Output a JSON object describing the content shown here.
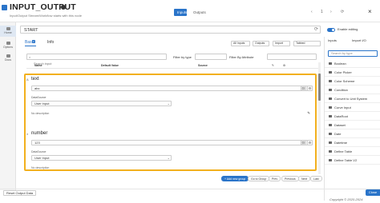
{
  "header": {
    "title": "INPUT_OUTPUT",
    "subtitle": "Input/Output Stream/Workflow starts with this node",
    "tabs": [
      "Inputs",
      "Outputs"
    ],
    "controls": [
      "‹",
      "1",
      "›",
      "⟳"
    ],
    "close": "×"
  },
  "left_nav": [
    {
      "label": "Home",
      "icon": "home-icon"
    },
    {
      "label": "Options",
      "icon": "options-icon"
    },
    {
      "label": "Docs",
      "icon": "docs-icon"
    }
  ],
  "name": {
    "value": "START",
    "refresh": "⟳"
  },
  "editing": {
    "label": "Enable editing",
    "enabled": true
  },
  "tabs": {
    "basic": "Basic",
    "basic_count": "2",
    "info": "Info"
  },
  "toolbar": {
    "all_inputs": "All Inputs",
    "outputs": "Outputs",
    "import": "Import",
    "view": "Tabbed"
  },
  "search": {
    "placeholder": "Search input"
  },
  "filters": {
    "type_label": "Filter by type",
    "attr_label": "Filter By Attribute"
  },
  "columns": {
    "name": "Name",
    "default": "Default Value",
    "source": "Source"
  },
  "inputs": [
    {
      "icon": "A",
      "name": "text",
      "value": "abc",
      "datasource_label": "DataSource",
      "datasource": "User Input",
      "description": "No description"
    },
    {
      "icon": "±",
      "name": "number",
      "value": "123",
      "datasource_label": "DataSource",
      "datasource": "User Input",
      "description": "No description"
    }
  ],
  "bottom_buttons": [
    "+ Add new group",
    "Go to Group",
    "Prev",
    "Previous",
    "Next",
    "Last"
  ],
  "right_panel": {
    "tabs": [
      "Inputs",
      "Import I/O"
    ],
    "search_placeholder": "Search by type",
    "items": [
      "Boolean",
      "Color Picker",
      "Color Scheme",
      "Condition",
      "Convert to Unit System",
      "Curve Input",
      "DataRoot",
      "Dataset",
      "Date",
      "Datetime",
      "Define Table",
      "Define Table V2"
    ]
  },
  "footer": {
    "reset_label": "Reset Output Data",
    "copyright": "Copyright © 2020-2024",
    "close_label": "Close"
  },
  "colors": {
    "accent": "#2a74c9",
    "highlight": "#f2b01e"
  }
}
